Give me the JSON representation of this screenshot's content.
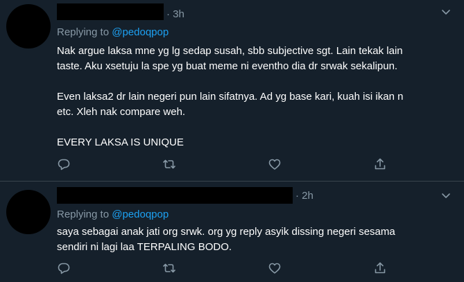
{
  "tweets": [
    {
      "time": "· 3h",
      "replying_prefix": "Replying to ",
      "replying_handle": "@pedoqpop",
      "lines": [
        "Nak argue laksa mne yg lg sedap susah, sbb subjective sgt. Lain tekak lain",
        "taste. Aku xsetuju la spe yg buat meme ni eventho dia dr srwak sekalipun.",
        "",
        "Even laksa2 dr lain negeri pun lain sifatnya. Ad yg base kari, kuah isi ikan n",
        "etc. Xleh nak compare weh.",
        "",
        "EVERY LAKSA IS UNIQUE"
      ],
      "icons": {
        "caret": "chevron-down-icon",
        "reply": "reply-icon",
        "retweet": "retweet-icon",
        "like": "heart-icon",
        "share": "share-icon"
      }
    },
    {
      "time": "· 2h",
      "replying_prefix": "Replying to ",
      "replying_handle": "@pedoqpop",
      "lines": [
        "saya sebagai anak jati org srwk. org yg reply asyik dissing negeri sesama",
        "sendiri ni lagi laa TERPALING BODO."
      ],
      "icons": {
        "caret": "chevron-down-icon",
        "reply": "reply-icon",
        "retweet": "retweet-icon",
        "like": "heart-icon",
        "share": "share-icon"
      }
    }
  ],
  "colors": {
    "background": "#15202b",
    "secondary_text": "#8899a6",
    "link": "#1da1f2",
    "divider": "#38444d"
  }
}
